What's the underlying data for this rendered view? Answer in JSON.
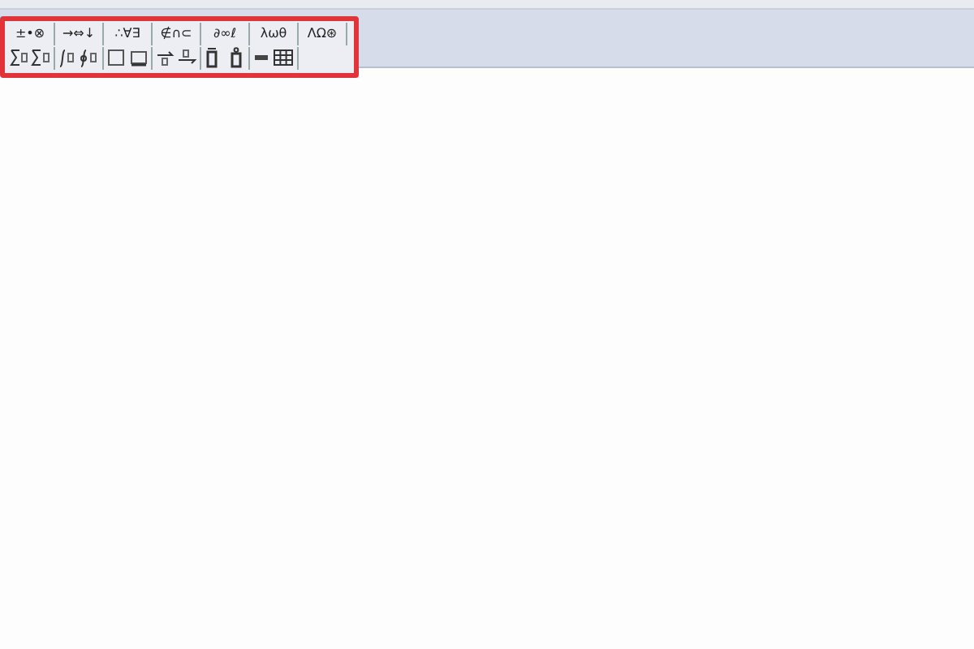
{
  "toolbar": {
    "highlighted": true,
    "symbol_palettes": [
      {
        "label": "±•⊗"
      },
      {
        "label": "→⇔↓"
      },
      {
        "label": "∴∀∃"
      },
      {
        "label": "∉∩⊂"
      },
      {
        "label": "∂∞ℓ"
      },
      {
        "label": "λωθ"
      },
      {
        "label": "ΛΩ⊛"
      }
    ],
    "template_palettes": [
      {
        "kind": "sum"
      },
      {
        "kind": "integral"
      },
      {
        "kind": "box"
      },
      {
        "kind": "arrow"
      },
      {
        "kind": "accent"
      },
      {
        "kind": "matrix"
      }
    ]
  }
}
